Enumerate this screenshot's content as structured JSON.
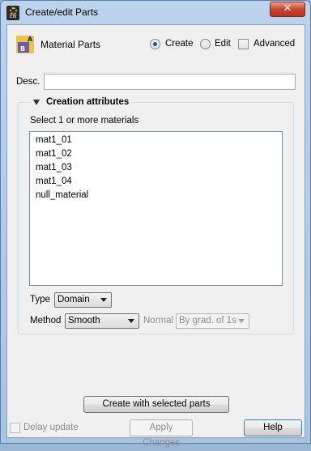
{
  "window": {
    "title": "Create/edit Parts",
    "close_label": "✕",
    "app_icon_text": "EN"
  },
  "header": {
    "title": "Material Parts",
    "mode_options": [
      {
        "label": "Create",
        "selected": true
      },
      {
        "label": "Edit",
        "selected": false
      }
    ],
    "advanced_label": "Advanced",
    "advanced_checked": false
  },
  "description": {
    "label": "Desc.",
    "value": ""
  },
  "creation_attributes": {
    "title": "Creation attributes",
    "expanded": true,
    "list_label": "Select 1 or more materials",
    "materials": [
      "mat1_01",
      "mat1_02",
      "mat1_03",
      "mat1_04",
      "null_material"
    ],
    "type_label": "Type",
    "type_value": "Domain",
    "method_label": "Method",
    "method_value": "Smooth",
    "normal_label": "Normal",
    "normal_value": "By grad. of 1s"
  },
  "footer": {
    "create_button": "Create with selected parts",
    "delay_update_label": "Delay update",
    "delay_update_checked": false,
    "apply_button": "Apply Changes",
    "help_button": "Help"
  },
  "colors": {
    "titlebar": "#b3cce8",
    "close_button": "#c7442f",
    "client_bg": "#f0f0f0",
    "radio_dot": "#2c4f85"
  }
}
